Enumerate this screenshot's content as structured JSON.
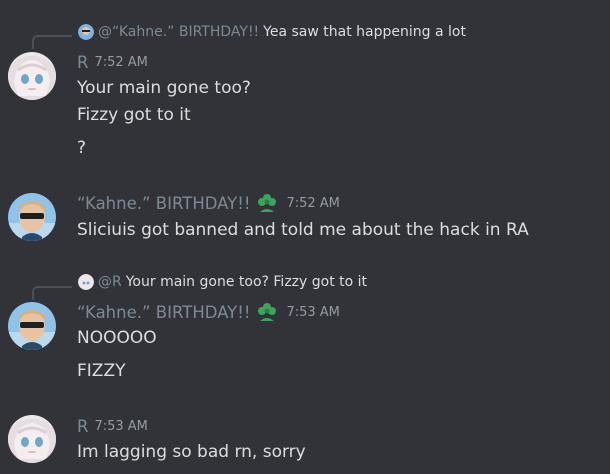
{
  "messages": [
    {
      "reply": {
        "author": "@“Kahne.” BIRTHDAY!!",
        "text": "Yea saw that happening a lot"
      },
      "author": "R",
      "time": "7:52 AM",
      "lines": [
        "Your main gone too?",
        "Fizzy got to it",
        "?"
      ]
    },
    {
      "author": "“Kahne.” BIRTHDAY!!",
      "badge_icon": "flower-badge-icon",
      "time": "7:52 AM",
      "lines": [
        "Sliciuis got banned and told me about the hack in RA"
      ]
    },
    {
      "reply": {
        "author": "@R",
        "text": "Your main gone too? Fizzy got to it"
      },
      "author": "“Kahne.” BIRTHDAY!!",
      "badge_icon": "flower-badge-icon",
      "time": "7:53 AM",
      "lines": [
        "NOOOOO",
        "FIZZY"
      ]
    },
    {
      "author": "R",
      "time": "7:53 AM",
      "lines": [
        "Im lagging so bad rn, sorry"
      ]
    }
  ],
  "colors": {
    "background": "#313338",
    "username": "#7d8a96",
    "timestamp": "#949ba4",
    "text": "#dbdee1",
    "badge": "#3ba55c"
  }
}
